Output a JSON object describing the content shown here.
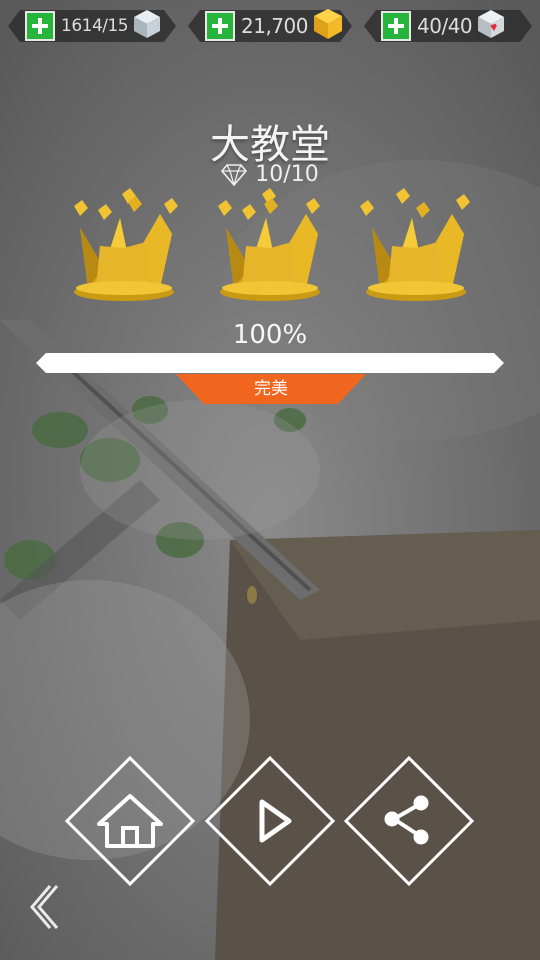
{
  "resources": {
    "ice": {
      "value": "1614/15",
      "icon": "ice-cube-icon"
    },
    "coins": {
      "value": "21,700",
      "icon": "gold-cube-icon"
    },
    "lives": {
      "value": "40/40",
      "icon": "heart-cube-icon"
    }
  },
  "level": {
    "title": "大教堂",
    "gems": "10/10",
    "crowns_earned": 3,
    "crowns_total": 3,
    "progress_label": "100%",
    "progress": 1.0,
    "rank": "完美"
  },
  "buttons": {
    "home": "home-icon",
    "play": "play-icon",
    "share": "share-icon",
    "back": "back-chevron-icon"
  },
  "colors": {
    "plus_green": "#27b43a",
    "gold": "#e8b423",
    "rank_orange": "#f0661e"
  }
}
